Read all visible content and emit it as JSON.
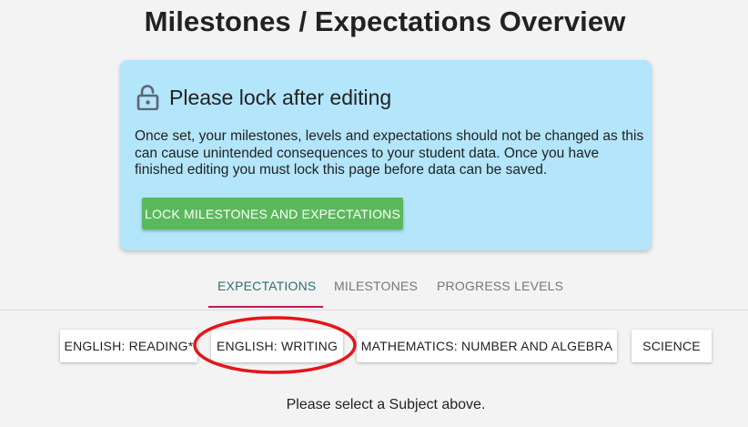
{
  "page": {
    "title": "Milestones / Expectations Overview"
  },
  "alert": {
    "icon": "lock-open-icon",
    "title": "Please lock after editing",
    "body": "Once set, your milestones, levels and expectations should not be changed as this can cause unintended consequences to your student data. Once you have finished editing you must lock this page before data can be saved.",
    "lock_button_label": "LOCK MILESTONES AND EXPECTATIONS",
    "background_color": "#b3e5fb",
    "button_color": "#5cb85c"
  },
  "tabs": [
    {
      "label": "EXPECTATIONS",
      "active": true
    },
    {
      "label": "MILESTONES",
      "active": false
    },
    {
      "label": "PROGRESS LEVELS",
      "active": false
    }
  ],
  "subjects": [
    {
      "label": "ENGLISH: READING*"
    },
    {
      "label": "ENGLISH: WRITING",
      "highlighted": true
    },
    {
      "label": "MATHEMATICS: NUMBER AND ALGEBRA"
    },
    {
      "label": "SCIENCE"
    }
  ],
  "highlight_color": "#e3161b",
  "tab_accent_color": "#c2185b",
  "helper_text": "Please select a Subject above."
}
